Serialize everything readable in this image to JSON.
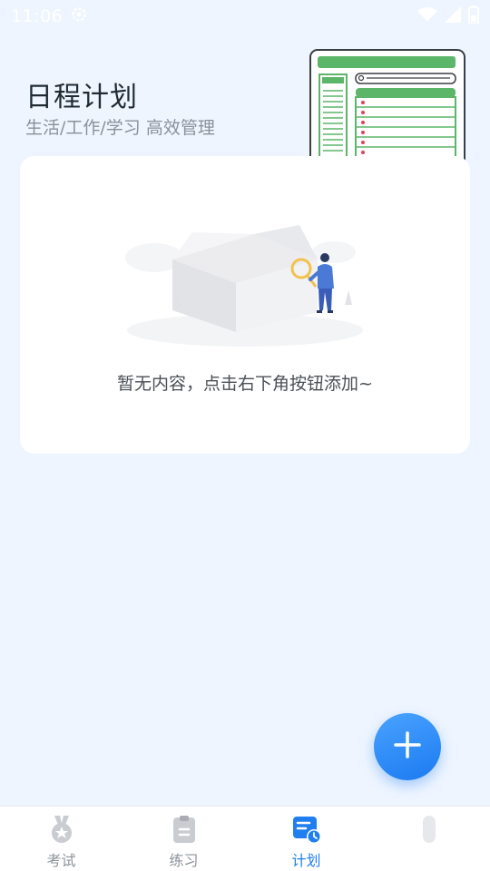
{
  "status_bar": {
    "time": "11:06",
    "icons": [
      "settings-gear-icon",
      "wifi-icon",
      "cellular-signal-icon",
      "battery-icon"
    ]
  },
  "header": {
    "title": "日程计划",
    "subtitle": "生活/工作/学习 高效管理"
  },
  "empty_state": {
    "message": "暂无内容，点击右下角按钮添加~"
  },
  "fab": {
    "icon": "plus-icon"
  },
  "bottom_nav": {
    "items": [
      {
        "label": "考试",
        "icon": "medal-icon",
        "active": false
      },
      {
        "label": "练习",
        "icon": "clipboard-icon",
        "active": false
      },
      {
        "label": "计划",
        "icon": "schedule-icon",
        "active": true
      },
      {
        "label": "",
        "icon": "profile-icon",
        "active": false
      }
    ]
  },
  "colors": {
    "background": "#eef5ff",
    "accent": "#1f7ff0",
    "card": "#ffffff",
    "illustration_green": "#5cb66a"
  }
}
